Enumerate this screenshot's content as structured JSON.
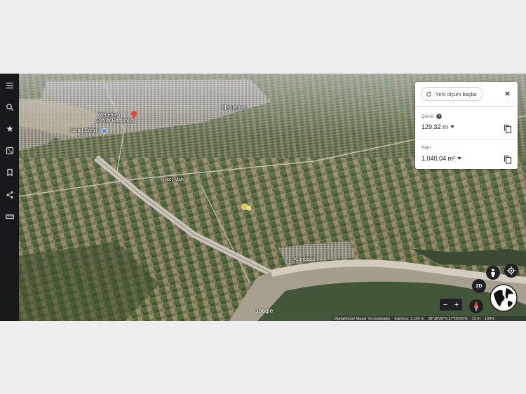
{
  "sidebar": {
    "items": [
      {
        "name": "menu-icon"
      },
      {
        "name": "search-icon"
      },
      {
        "name": "voyager-icon"
      },
      {
        "name": "feeling-lucky-icon"
      },
      {
        "name": "projects-icon"
      },
      {
        "name": "share-icon"
      },
      {
        "name": "ruler-icon"
      }
    ]
  },
  "map": {
    "labels": {
      "district_1": "Menemen",
      "district_2": "Dede Mahalli",
      "poi_1": "Menemen",
      "poi_2": "Devlet Hastanesi",
      "poi_3": "Yaşad Camii",
      "road": "Hacı Mah.",
      "village": "Kumbaba"
    }
  },
  "measure": {
    "new_label": "Yeni ölçüm başlat",
    "perimeter_label": "Çevre",
    "perimeter_value": "129,32 m",
    "area_label": "Alan",
    "area_value": "1.040,04 m²"
  },
  "controls": {
    "btn_2d": "2D",
    "zoom_out": "−",
    "zoom_in": "+"
  },
  "attribution": {
    "google": "Google",
    "provider": "DigitalGlobe Maxar Technologies",
    "camera": "Kamera: 1.136 m",
    "coords": "38°38'20\"N 27°05'50\"E",
    "elevation": "13 m",
    "progress": "100%"
  },
  "colors": {
    "sidebar": "#17181a",
    "accent": "#1a73e8",
    "pin": "#ea4335"
  }
}
